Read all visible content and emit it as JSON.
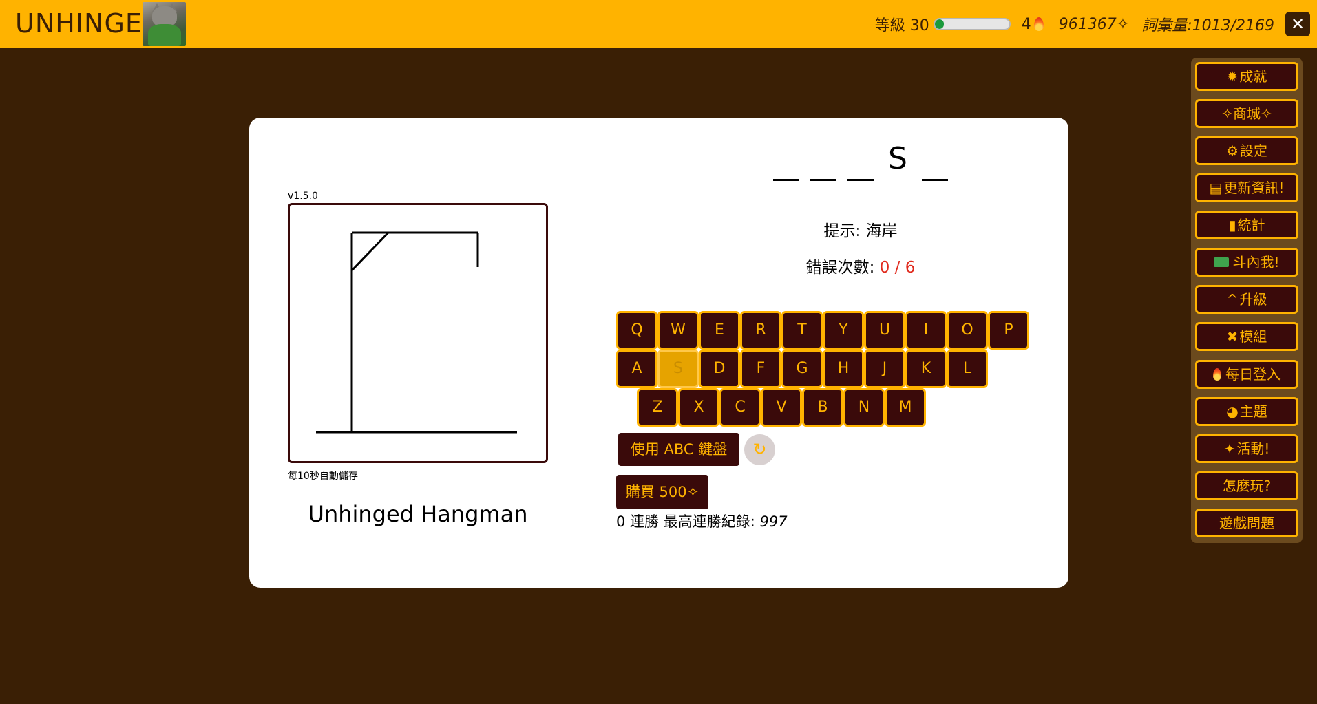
{
  "header": {
    "brand": "UNHINGED",
    "level_label": "等級 30",
    "xp_progress": 0.12,
    "streak_count": "4",
    "coins": "961367✧",
    "vocab": "詞彙量:1013/2169",
    "close_label": "✕"
  },
  "game": {
    "version": "v1.5.0",
    "autosave_note": "每10秒自動儲存",
    "title": "Unhinged Hangman",
    "word_slots": [
      "",
      "",
      "",
      "S",
      ""
    ],
    "hint_label": "提示: ",
    "hint_value": "海岸",
    "mistakes_label": "錯誤次數: ",
    "mistakes_value": "0 / 6"
  },
  "keyboard": {
    "row1": [
      "Q",
      "W",
      "E",
      "R",
      "T",
      "Y",
      "U",
      "I",
      "O",
      "P"
    ],
    "row2": [
      "A",
      "S",
      "D",
      "F",
      "G",
      "H",
      "J",
      "K",
      "L"
    ],
    "row3": [
      "Z",
      "X",
      "C",
      "V",
      "B",
      "N",
      "M"
    ],
    "used_letters": [
      "S"
    ],
    "abc_label": "使用 ABC 鍵盤",
    "reset_icon": "refresh-icon",
    "buy_label": "購買 500✧",
    "streak_text": "0 連勝 最高連勝紀錄: ",
    "best_streak": "997"
  },
  "sidebar": {
    "achievements": "成就",
    "shop": "✧商城✧",
    "settings": "設定",
    "updates": "更新資訊!",
    "stats": "統計",
    "donate": "斗內我!",
    "upgrade": "升級",
    "mods": "模組",
    "daily": "每日登入",
    "theme": "主題",
    "events": "活動!",
    "howto": "怎麼玩?",
    "issues": "遊戲問題"
  },
  "colors": {
    "accent": "#ffb300",
    "dark": "#3a0a0a",
    "background": "#3a1f05",
    "error_count": "#e0291c"
  }
}
